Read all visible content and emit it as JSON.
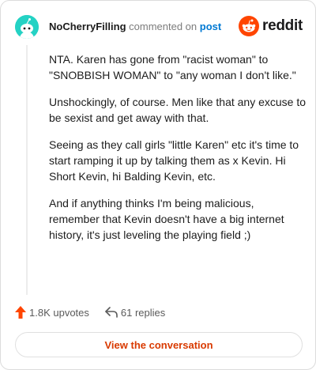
{
  "header": {
    "username": "NoCherryFilling",
    "commented_text": "commented on",
    "post_link": "post",
    "brand_word": "reddit"
  },
  "comment": {
    "paragraphs": [
      "NTA. Karen has gone from \"racist woman\" to \"SNOBBISH WOMAN\" to \"any woman I don't like.\"",
      "Unshockingly, of course. Men like that any excuse to be sexist and get away with that.",
      "Seeing as they call girls \"little Karen\" etc it's time to start ramping it up by talking them as x Kevin. Hi Short Kevin, hi Balding Kevin, etc.",
      "And if anything thinks I'm being malicious, remember that Kevin doesn't have a big internet history, it's just leveling the playing field ;)"
    ]
  },
  "footer": {
    "upvotes": "1.8K upvotes",
    "replies": "61 replies",
    "view_button": "View the conversation"
  },
  "icons": {
    "avatar": "snoo-avatar-icon",
    "brand": "reddit-logo-icon",
    "upvote": "upvote-arrow-icon",
    "reply": "reply-arrow-icon"
  },
  "colors": {
    "brand_orange": "#ff4500",
    "link_blue": "#0079d3",
    "button_text": "#d93a00",
    "avatar_bg": "#24d2c4"
  }
}
